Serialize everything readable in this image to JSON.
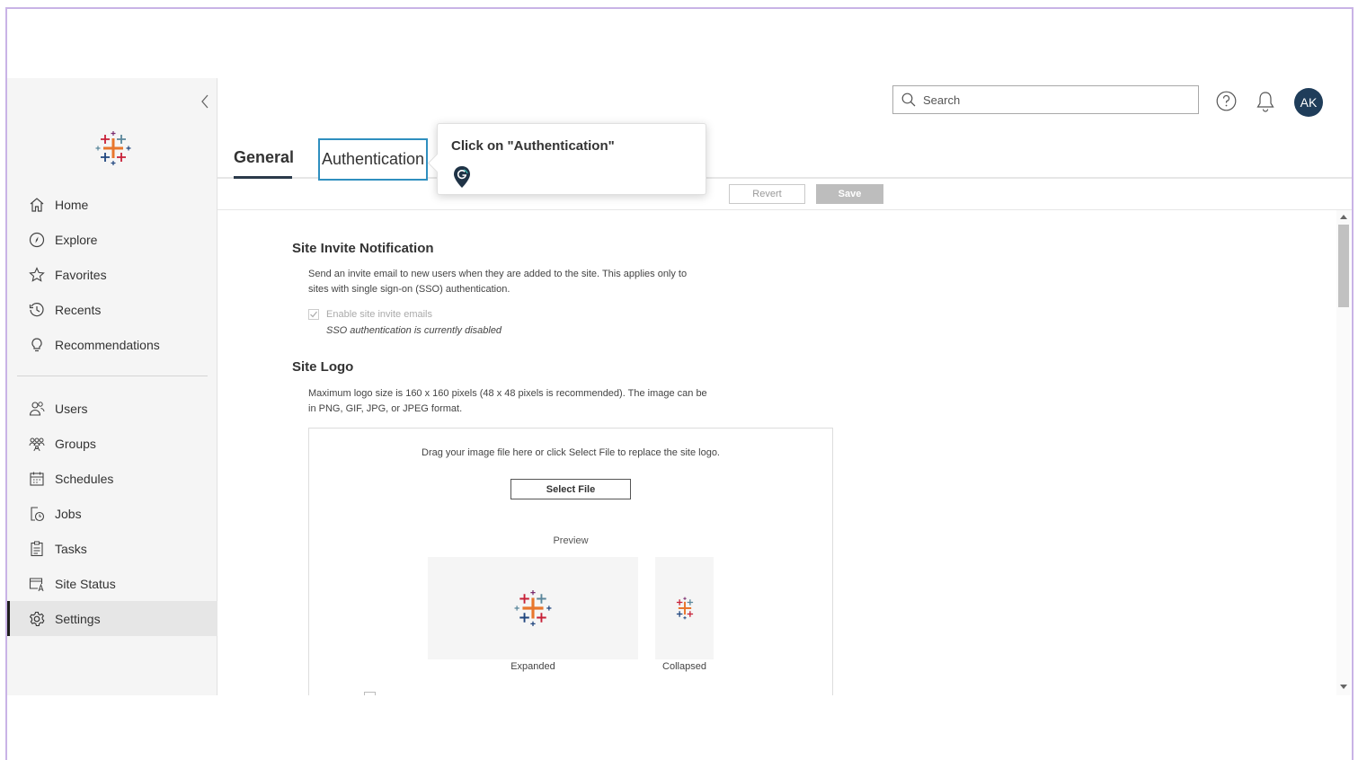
{
  "header": {
    "search_placeholder": "Search",
    "avatar_initials": "AK"
  },
  "sidebar": {
    "items_top": [
      {
        "label": "Home",
        "icon": "home-icon"
      },
      {
        "label": "Explore",
        "icon": "compass-icon"
      },
      {
        "label": "Favorites",
        "icon": "star-icon"
      },
      {
        "label": "Recents",
        "icon": "history-icon"
      },
      {
        "label": "Recommendations",
        "icon": "lightbulb-icon"
      }
    ],
    "items_bottom": [
      {
        "label": "Users",
        "icon": "users-icon"
      },
      {
        "label": "Groups",
        "icon": "groups-icon"
      },
      {
        "label": "Schedules",
        "icon": "calendar-icon"
      },
      {
        "label": "Jobs",
        "icon": "jobs-icon"
      },
      {
        "label": "Tasks",
        "icon": "clipboard-icon"
      },
      {
        "label": "Site Status",
        "icon": "site-status-icon"
      },
      {
        "label": "Settings",
        "icon": "gear-icon",
        "active": true
      }
    ]
  },
  "tabs": {
    "general": "General",
    "authentication": "Authentication"
  },
  "tooltip": {
    "text": "Click on \"Authentication\""
  },
  "toolbar": {
    "revert_label": "Revert",
    "save_label": "Save"
  },
  "site_invite": {
    "title": "Site Invite Notification",
    "desc_line1": "Send an invite email to new users when they are added to the site. This applies only to",
    "desc_line2": "sites with single sign-on (SSO) authentication.",
    "checkbox_label": "Enable site invite emails",
    "checkbox_checked": true,
    "note": "SSO authentication is currently disabled"
  },
  "site_logo": {
    "title": "Site Logo",
    "desc_line1": "Maximum logo size is 160 x 160 pixels (48 x 48 pixels is recommended). The image can be",
    "desc_line2": "in PNG, GIF, JPG, or JPEG format.",
    "drop_hint": "Drag your image file here or click Select File to replace the site logo.",
    "select_file_label": "Select File",
    "preview_label": "Preview",
    "expanded_label": "Expanded",
    "collapsed_label": "Collapsed"
  },
  "colors": {
    "accent": "#2f8fbf",
    "avatar_bg": "#1f3d5a",
    "logo_orange": "#e8762d",
    "logo_red": "#c72037",
    "logo_blue": "#5b879b",
    "logo_navy": "#1f457e",
    "logo_purple": "#7b2c6e",
    "logo_teal": "#59879b"
  }
}
